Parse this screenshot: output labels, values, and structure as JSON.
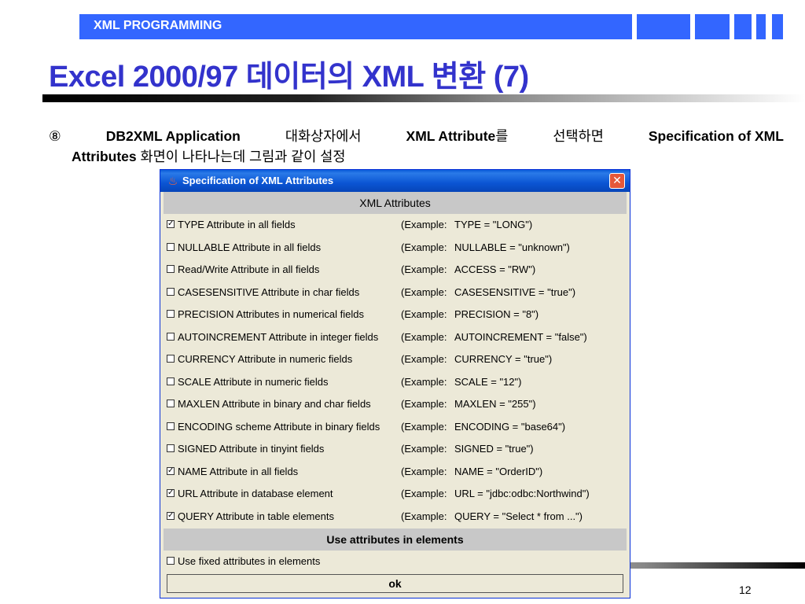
{
  "slide": {
    "header_label": "XML PROGRAMMING",
    "title": "Excel 2000/97 데이터의 XML 변환 (7)",
    "page_number": "12",
    "accent_color": "#3366ff",
    "title_color": "#3333cc"
  },
  "body": {
    "marker": "⑧",
    "parts": [
      {
        "text": "DB2XML Application",
        "bold": true
      },
      {
        "text": "대화상자에서",
        "bold": false
      },
      {
        "text": "XML Attribute를",
        "bold_prefix": "XML Attribute",
        "suffix": "를"
      },
      {
        "text": "선택하면",
        "bold": false
      },
      {
        "text": "Specification of XML",
        "bold": true
      }
    ],
    "line2_bold": "Attributes",
    "line2_rest": "화면이 나타나는데 그림과 같이 설정"
  },
  "dialog": {
    "title": "Specification of  XML Attributes",
    "section_attrs": "XML Attributes",
    "section_use": "Use attributes  in elements",
    "ok_label": "ok",
    "example_prefix": "(Example:",
    "rows": [
      {
        "label": "TYPE Attribute in all fields",
        "example": "TYPE = \"LONG\")",
        "checked": true
      },
      {
        "label": "NULLABLE Attribute in all fields",
        "example": "NULLABLE = \"unknown\")",
        "checked": false
      },
      {
        "label": "Read/Write Attribute in all fields",
        "example": "ACCESS = \"RW\")",
        "checked": false
      },
      {
        "label": "CASESENSITIVE Attribute in char fields",
        "example": "CASESENSITIVE = \"true\")",
        "checked": false
      },
      {
        "label": "PRECISION Attributes in numerical fields",
        "example": "PRECISION = \"8\")",
        "checked": false
      },
      {
        "label": "AUTOINCREMENT Attribute in integer fields",
        "example": "AUTOINCREMENT = \"false\")",
        "checked": false
      },
      {
        "label": "CURRENCY Attribute in numeric fields",
        "example": "CURRENCY = \"true\")",
        "checked": false
      },
      {
        "label": "SCALE Attribute in numeric fields",
        "example": "SCALE = \"12\")",
        "checked": false
      },
      {
        "label": "MAXLEN Attribute in binary and char fields",
        "example": "MAXLEN = \"255\")",
        "checked": false
      },
      {
        "label": "ENCODING scheme Attribute in binary fields",
        "example": "ENCODING = \"base64\")",
        "checked": false
      },
      {
        "label": "SIGNED Attribute in tinyint fields",
        "example": "SIGNED = \"true\")",
        "checked": false
      },
      {
        "label": "NAME Attribute in all fields",
        "example": "NAME = \"OrderID\")",
        "checked": true
      },
      {
        "label": "URL Attribute in database element",
        "example": "URL = \"jdbc:odbc:Northwind\")",
        "checked": true
      },
      {
        "label": "QUERY Attribute in table elements",
        "example": "QUERY = \"Select * from ...\")",
        "checked": true
      }
    ],
    "fixed_row": {
      "label": "Use fixed attributes in elements",
      "checked": false
    }
  }
}
